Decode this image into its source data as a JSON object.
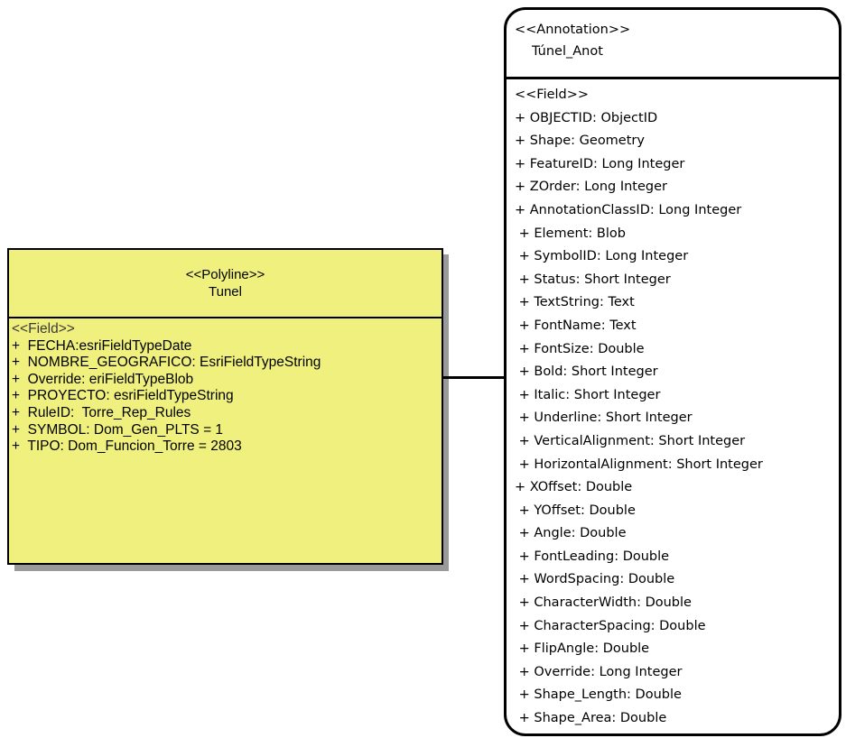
{
  "polyline_class": {
    "stereotype": "<<Polyline>>",
    "name": "Tunel",
    "field_stereotype": "<<Field>>",
    "fields": [
      "+  FECHA:esriFieldTypeDate",
      "+  NOMBRE_GEOGRAFICO: EsriFieldTypeString",
      "+  Override: eriFieldTypeBlob",
      "+  PROYECTO: esriFieldTypeString",
      "+  RuleID:  Torre_Rep_Rules",
      "+  SYMBOL: Dom_Gen_PLTS = 1",
      "+  TIPO: Dom_Funcion_Torre = 2803"
    ],
    "fill_color": "#f0f07e",
    "shadow_color": "#9a9a9a"
  },
  "annotation_class": {
    "stereotype": "<<Annotation>>",
    "name": "Túnel_Anot",
    "field_stereotype": "<<Field>>",
    "fields": [
      "+ OBJECTID: ObjectID",
      "+ Shape: Geometry",
      "+ FeatureID: Long Integer",
      "+ ZOrder: Long Integer",
      "+ AnnotationClassID: Long Integer",
      " + Element: Blob",
      " + SymbolID: Long Integer",
      " + Status: Short Integer",
      " + TextString: Text",
      " + FontName: Text",
      " + FontSize: Double",
      " + Bold: Short Integer",
      " + Italic: Short Integer",
      " + Underline: Short Integer",
      " + VerticalAlignment: Short Integer",
      " + HorizontalAlignment: Short Integer",
      "+ XOffset: Double",
      " + YOffset: Double",
      " + Angle: Double",
      " + FontLeading: Double",
      " + WordSpacing: Double",
      " + CharacterWidth: Double",
      " + CharacterSpacing: Double",
      " + FlipAngle: Double",
      " + Override: Long Integer",
      " + Shape_Length: Double",
      " + Shape_Area: Double"
    ]
  }
}
